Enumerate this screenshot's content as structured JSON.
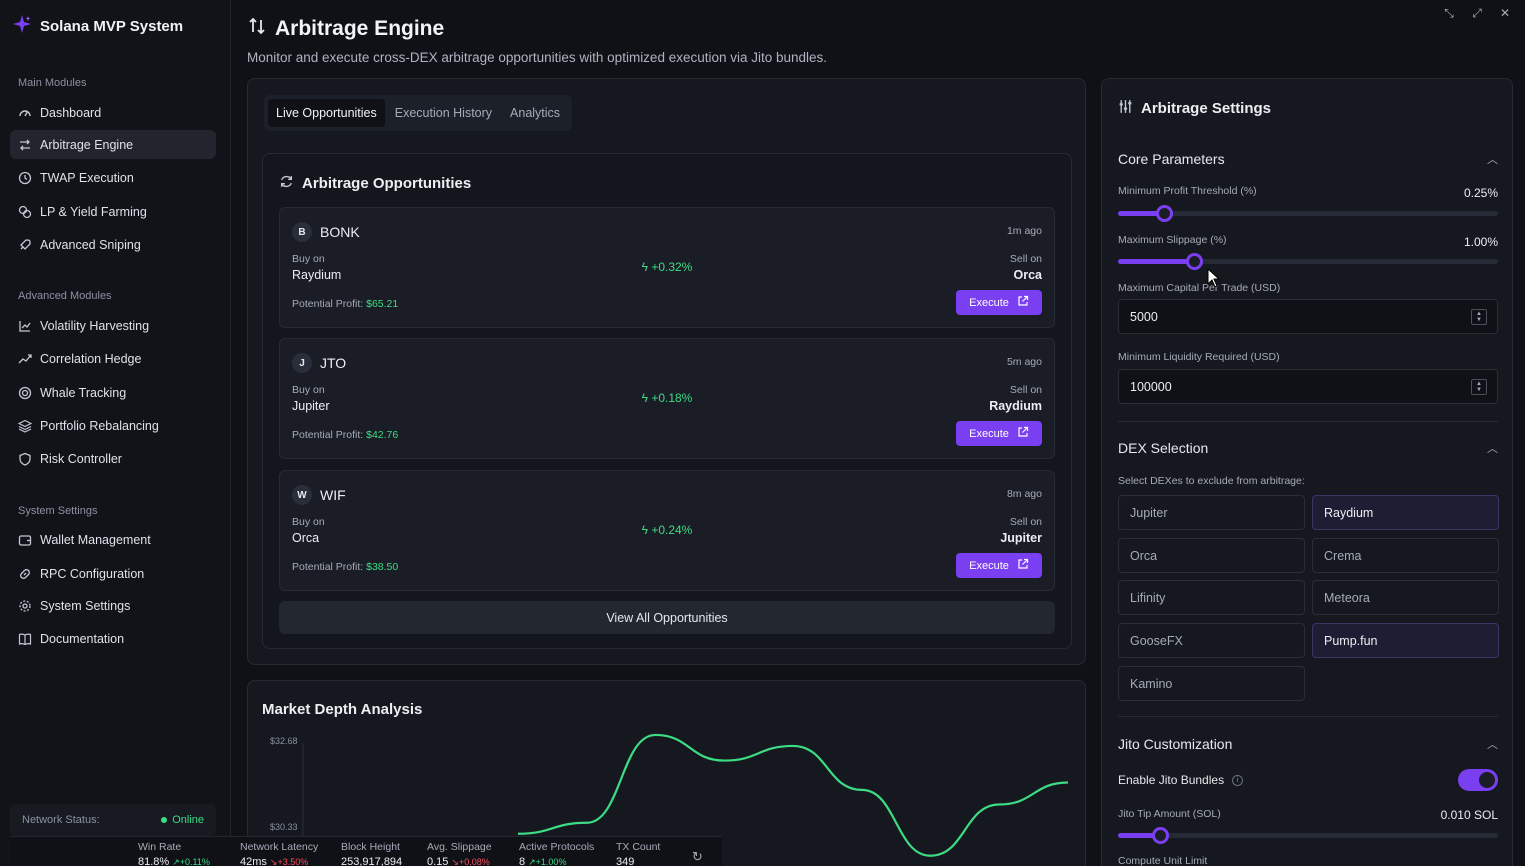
{
  "app": {
    "title": "Solana MVP System"
  },
  "sidebar": {
    "sections": [
      {
        "label": "Main Modules"
      },
      {
        "label": "Advanced Modules"
      },
      {
        "label": "System Settings"
      }
    ],
    "items": [
      {
        "label": "Dashboard",
        "icon": "gauge-icon"
      },
      {
        "label": "Arbitrage Engine",
        "icon": "arrows-swap-icon"
      },
      {
        "label": "TWAP Execution",
        "icon": "clock-icon"
      },
      {
        "label": "LP & Yield Farming",
        "icon": "coins-icon"
      },
      {
        "label": "Advanced Sniping",
        "icon": "rocket-icon"
      },
      {
        "label": "Volatility Harvesting",
        "icon": "chart-line-icon"
      },
      {
        "label": "Correlation Hedge",
        "icon": "trending-icon"
      },
      {
        "label": "Whale Tracking",
        "icon": "target-icon"
      },
      {
        "label": "Portfolio Rebalancing",
        "icon": "layers-icon"
      },
      {
        "label": "Risk Controller",
        "icon": "shield-icon"
      },
      {
        "label": "Wallet Management",
        "icon": "wallet-icon"
      },
      {
        "label": "RPC Configuration",
        "icon": "link-icon"
      },
      {
        "label": "System Settings",
        "icon": "gear-icon"
      },
      {
        "label": "Documentation",
        "icon": "book-icon"
      }
    ],
    "network": {
      "label": "Network Status:",
      "value": "Online"
    }
  },
  "header": {
    "title": "Arbitrage Engine",
    "subtitle": "Monitor and execute cross-DEX arbitrage opportunities with optimized execution via Jito bundles."
  },
  "tabs": [
    {
      "label": "Live Opportunities",
      "active": true
    },
    {
      "label": "Execution History",
      "active": false
    },
    {
      "label": "Analytics",
      "active": false
    }
  ],
  "opportunities": {
    "title": "Arbitrage Opportunities",
    "buy_label": "Buy on",
    "sell_label": "Sell on",
    "profit_label": "Potential Profit:",
    "execute_label": "Execute",
    "view_all_label": "View All Opportunities",
    "items": [
      {
        "badge": "B",
        "token": "BONK",
        "time": "1m ago",
        "buy_dex": "Raydium",
        "sell_dex": "Orca",
        "spread": "+0.32%",
        "profit": "$65.21"
      },
      {
        "badge": "J",
        "token": "JTO",
        "time": "5m ago",
        "buy_dex": "Jupiter",
        "sell_dex": "Raydium",
        "spread": "+0.18%",
        "profit": "$42.76"
      },
      {
        "badge": "W",
        "token": "WIF",
        "time": "8m ago",
        "buy_dex": "Orca",
        "sell_dex": "Jupiter",
        "spread": "+0.24%",
        "profit": "$38.50"
      }
    ]
  },
  "market_depth": {
    "title": "Market Depth Analysis",
    "y_ticks": [
      "$32.68",
      "$30.33"
    ]
  },
  "chart_data": {
    "type": "line",
    "title": "Market Depth Analysis",
    "y_tick_labels": [
      "$32.68",
      "$30.33"
    ],
    "series": [
      {
        "values": [
          30.2,
          30.5,
          32.9,
          32.2,
          32.6,
          31.4,
          29.6,
          31.0,
          31.6
        ]
      }
    ],
    "grid": false
  },
  "settings": {
    "title": "Arbitrage Settings",
    "core": {
      "title": "Core Parameters",
      "min_profit": {
        "label": "Minimum Profit Threshold (%)",
        "value": "0.25%",
        "fraction": 0.12
      },
      "max_slippage": {
        "label": "Maximum Slippage (%)",
        "value": "1.00%",
        "fraction": 0.2
      },
      "max_capital": {
        "label": "Maximum Capital Per Trade (USD)",
        "value": "5000"
      },
      "min_liquidity": {
        "label": "Minimum Liquidity Required (USD)",
        "value": "100000"
      }
    },
    "dex": {
      "title": "DEX Selection",
      "hint": "Select DEXes to exclude from arbitrage:",
      "options": [
        {
          "label": "Jupiter",
          "selected": false
        },
        {
          "label": "Raydium",
          "selected": true
        },
        {
          "label": "Orca",
          "selected": false
        },
        {
          "label": "Crema",
          "selected": false
        },
        {
          "label": "Lifinity",
          "selected": false
        },
        {
          "label": "Meteora",
          "selected": false
        },
        {
          "label": "GooseFX",
          "selected": false
        },
        {
          "label": "Pump.fun",
          "selected": true
        },
        {
          "label": "Kamino",
          "selected": false
        }
      ]
    },
    "jito": {
      "title": "Jito Customization",
      "enable_label": "Enable Jito Bundles",
      "enabled": true,
      "tip_label": "Jito Tip Amount (SOL)",
      "tip_value": "0.010 SOL",
      "tip_fraction": 0.11,
      "compute_label": "Compute Unit Limit"
    }
  },
  "stats": [
    {
      "label": "Win Rate",
      "value": "81.8%",
      "delta": "↗+0.11%",
      "dir": "up"
    },
    {
      "label": "Network Latency",
      "value": "42ms",
      "delta": "↘+3.50%",
      "dir": "down"
    },
    {
      "label": "Block Height",
      "value": "253,917,894",
      "delta": "",
      "dir": ""
    },
    {
      "label": "Avg. Slippage",
      "value": "0.15",
      "delta": "↘+0.08%",
      "dir": "down"
    },
    {
      "label": "Active Protocols",
      "value": "8",
      "delta": "↗+1.00%",
      "dir": "up"
    },
    {
      "label": "TX Count",
      "value": "349",
      "delta": "",
      "dir": ""
    }
  ],
  "colors": {
    "accent": "#7b3ff2",
    "positive": "#3ddc84",
    "negative": "#ff4d5e"
  }
}
